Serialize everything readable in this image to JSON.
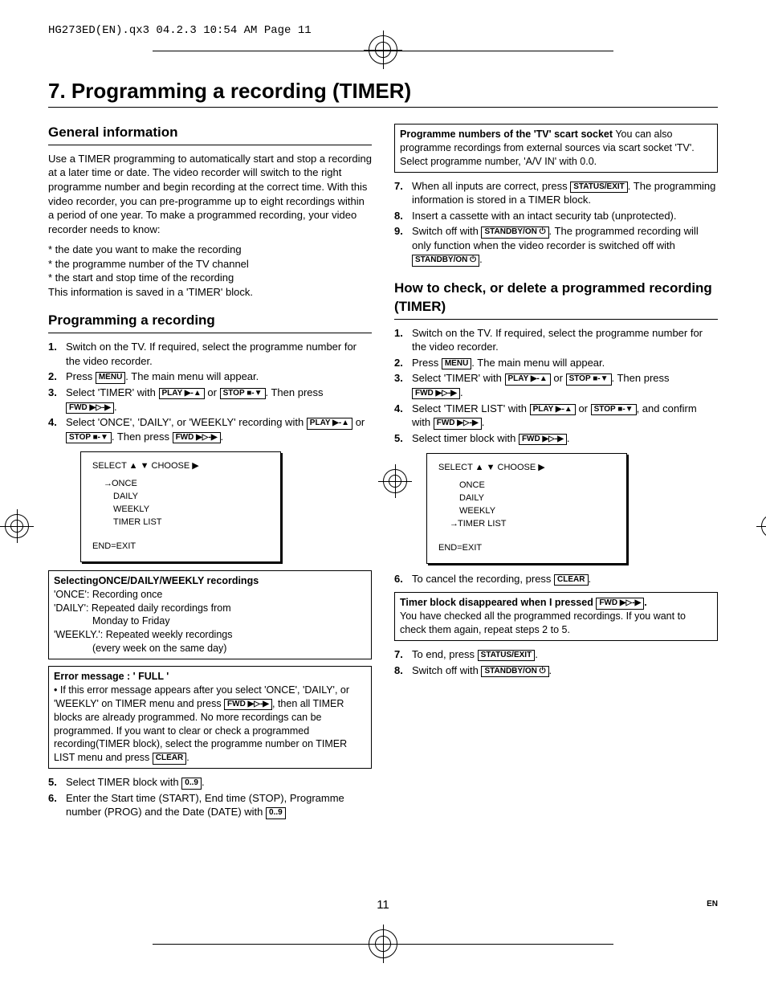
{
  "header_line": "HG273ED(EN).qx3  04.2.3  10:54 AM  Page 11",
  "title": "7. Programming a recording (TIMER)",
  "page_number": "11",
  "lang_code": "EN",
  "buttons": {
    "menu": "MENU",
    "play": "PLAY ▶-▲",
    "stop": "STOP ■-▼",
    "fwd": "FWD ▶▷-▶",
    "clear": "CLEAR",
    "digits": "0..9",
    "status_exit": "STATUS/EXIT",
    "standby": "STANDBY/ON ⏻"
  },
  "left": {
    "sec1_title": "General information",
    "general_para": "Use a TIMER programming to automatically start and stop a recording at a later time or date. The video recorder will switch to the right programme number and begin recording at the correct time. With this video recorder, you can pre-programme up to eight recordings within a period of one year. To make a programmed recording, your video recorder needs to know:",
    "bullets": [
      "* the date you want to make the recording",
      "* the programme number of the TV channel",
      "* the start and stop time of the recording"
    ],
    "general_tail": "This information is saved in a 'TIMER' block.",
    "sec2_title": "Programming a recording",
    "steps_a": {
      "s1": "Switch on the TV. If required, select the programme number for the video recorder.",
      "s2a": "Press ",
      "s2b": ". The main menu will appear.",
      "s3a": "Select 'TIMER' with ",
      "s3_or": " or ",
      "s3b": ". Then press ",
      "s3c": ".",
      "s4a": "Select 'ONCE', 'DAILY', or 'WEEKLY' recording with ",
      "s4_or": " or ",
      "s4b": ". Then press ",
      "s4c": "."
    },
    "menu_box1": {
      "top": "SELECT ▲ ▼  CHOOSE ▶",
      "items": [
        "ONCE",
        "DAILY",
        "WEEKLY",
        "TIMER LIST"
      ],
      "selected": "ONCE",
      "end": "END=EXIT"
    },
    "box_selecting_title": "SelectingONCE/DAILY/WEEKLY recordings",
    "box_selecting_lines": [
      "'ONCE': Recording once",
      "'DAILY': Repeated daily recordings from",
      "Monday to Friday",
      "'WEEKLY.': Repeated weekly recordings",
      "(every week on the same day)"
    ],
    "box_error_title": "Error message : ' FULL '",
    "box_error_text_a": "• If this error message appears after you select 'ONCE', 'DAILY', or 'WEEKLY' on TIMER menu and press ",
    "box_error_text_b": ", then all TIMER blocks are already programmed. No more recordings can be programmed. If you want to clear or check a programmed recording(TIMER block), select the programme number on TIMER LIST menu and press ",
    "box_error_text_c": ".",
    "steps_b": {
      "s5a": "Select TIMER block with ",
      "s5b": ".",
      "s6a": "Enter the Start time (START), End time (STOP), Programme number (PROG) and the Date (DATE) with "
    }
  },
  "right": {
    "box_prog_title": "Programme numbers of the 'TV' scart socket",
    "box_prog_text": "You can also programme recordings from external sources via scart socket 'TV'. Select programme number, 'A/V IN' with 0.0.",
    "steps_c": {
      "s7a": "When all inputs are correct, press ",
      "s7b": ". The programming information is stored in a TIMER block.",
      "s8": "Insert a cassette with an intact security tab (unprotected).",
      "s9a": "Switch off with ",
      "s9b": ". The programmed recording will only function when the video recorder is switched off with ",
      "s9c": "."
    },
    "sec3_title": "How to check, or delete a programmed recording (TIMER)",
    "steps_d": {
      "s1": "Switch on the TV. If required, select the programme number for the video recorder.",
      "s2a": "Press ",
      "s2b": ". The main menu will appear.",
      "s3a": "Select 'TIMER' with ",
      "s3_or": " or ",
      "s3b": ". Then press ",
      "s3c": ".",
      "s4a": "Select 'TIMER LIST' with ",
      "s4_or": " or ",
      "s4b": ", and confirm with ",
      "s4c": ".",
      "s5a": "Select timer block with ",
      "s5b": "."
    },
    "menu_box2": {
      "top": "SELECT ▲ ▼  CHOOSE ▶",
      "items": [
        "ONCE",
        "DAILY",
        "WEEKLY",
        "TIMER LIST"
      ],
      "selected": "TIMER LIST",
      "end": "END=EXIT"
    },
    "steps_e": {
      "s6a": "To cancel the recording, press ",
      "s6b": "."
    },
    "box_disappear_title_a": "Timer block disappeared when I pressed ",
    "box_disappear_title_b": ".",
    "box_disappear_text": "You have checked all the programmed recordings. If you want to check them again, repeat steps 2 to 5.",
    "steps_f": {
      "s7a": "To end, press ",
      "s7b": ".",
      "s8a": "Switch off with ",
      "s8b": "."
    }
  }
}
